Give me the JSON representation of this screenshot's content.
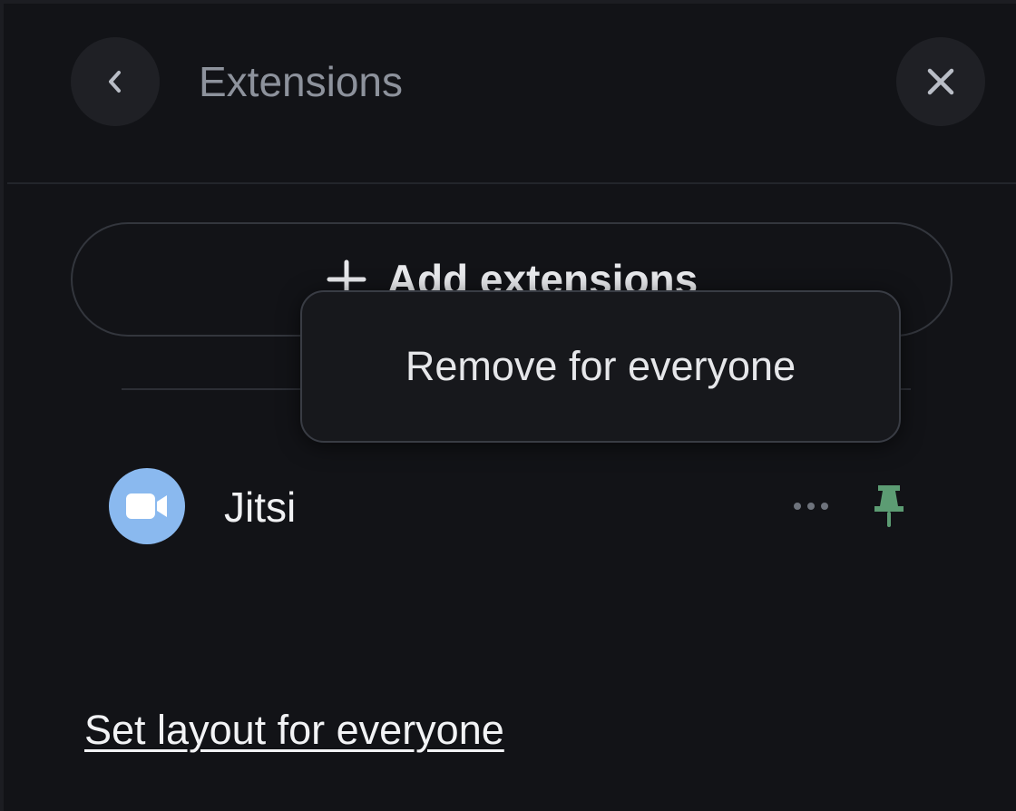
{
  "header": {
    "title": "Extensions",
    "back_icon": "chevron-left-icon",
    "close_icon": "close-icon"
  },
  "actions": {
    "add_label": "Add extensions",
    "add_icon": "plus-icon"
  },
  "tooltip": {
    "label": "Remove for everyone"
  },
  "extensions": [
    {
      "name": "Jitsi",
      "icon": "video-camera-icon",
      "icon_color": "#8ab9ef",
      "more_icon": "more-options-icon",
      "pin_icon": "pin-icon",
      "pin_color": "#5c9c73",
      "pinned": true
    }
  ],
  "footer": {
    "layout_link": "Set layout for everyone"
  },
  "colors": {
    "background": "#121317",
    "button_background": "#1f2025",
    "title_text": "#8d929c",
    "primary_text": "#f0f1f3"
  }
}
